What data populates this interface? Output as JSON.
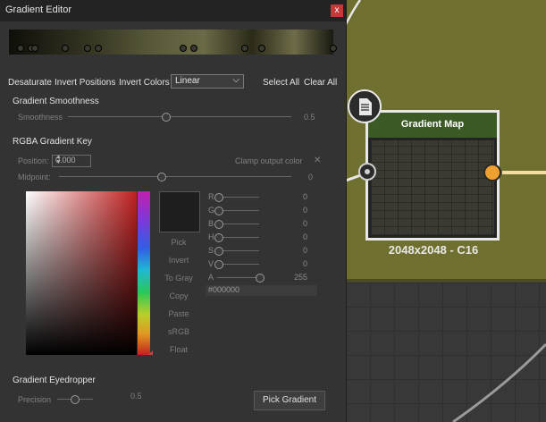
{
  "window": {
    "title": "Gradient Editor",
    "close_glyph": "x"
  },
  "toolbar": {
    "desaturate": "Desaturate",
    "invert_positions": "Invert Positions",
    "invert_colors": "Invert Colors",
    "interpolation": "Linear",
    "select_all": "Select All",
    "clear_all": "Clear All"
  },
  "smoothness": {
    "section": "Gradient Smoothness",
    "label": "Smoothness",
    "value": "0.5",
    "fraction": 0.5
  },
  "key": {
    "section": "RGBA Gradient Key",
    "position_label": "Position:",
    "position_value": "0.000",
    "clamp_label": "Clamp output color",
    "midpoint_label": "Midpoint:",
    "midpoint_value": "0",
    "midpoint_fraction": 0.5
  },
  "actions": [
    "Pick",
    "Invert",
    "To Gray",
    "Copy",
    "Paste",
    "sRGB",
    "Float"
  ],
  "channels": [
    {
      "name": "R",
      "value": "0",
      "fraction": 0
    },
    {
      "name": "G",
      "value": "0",
      "fraction": 0
    },
    {
      "name": "B",
      "value": "0",
      "fraction": 0
    },
    {
      "name": "H",
      "value": "0",
      "fraction": 0
    },
    {
      "name": "S",
      "value": "0",
      "fraction": 0
    },
    {
      "name": "V",
      "value": "0",
      "fraction": 0
    },
    {
      "name": "A",
      "value": "255",
      "fraction": 1
    }
  ],
  "hex_value": "#000000",
  "eyedropper": {
    "section": "Gradient Eyedropper",
    "precision_label": "Precision",
    "precision_value": "0.5",
    "precision_fraction": 0.5,
    "button": "Pick Gradient"
  },
  "node": {
    "title": "Gradient Map",
    "size_label": "2048x2048 - C16"
  },
  "colors": {
    "graph_bg": "#6f6f2f",
    "node_header": "#3c5a26",
    "output_port": "#f0a030",
    "close": "#c43a3a"
  }
}
